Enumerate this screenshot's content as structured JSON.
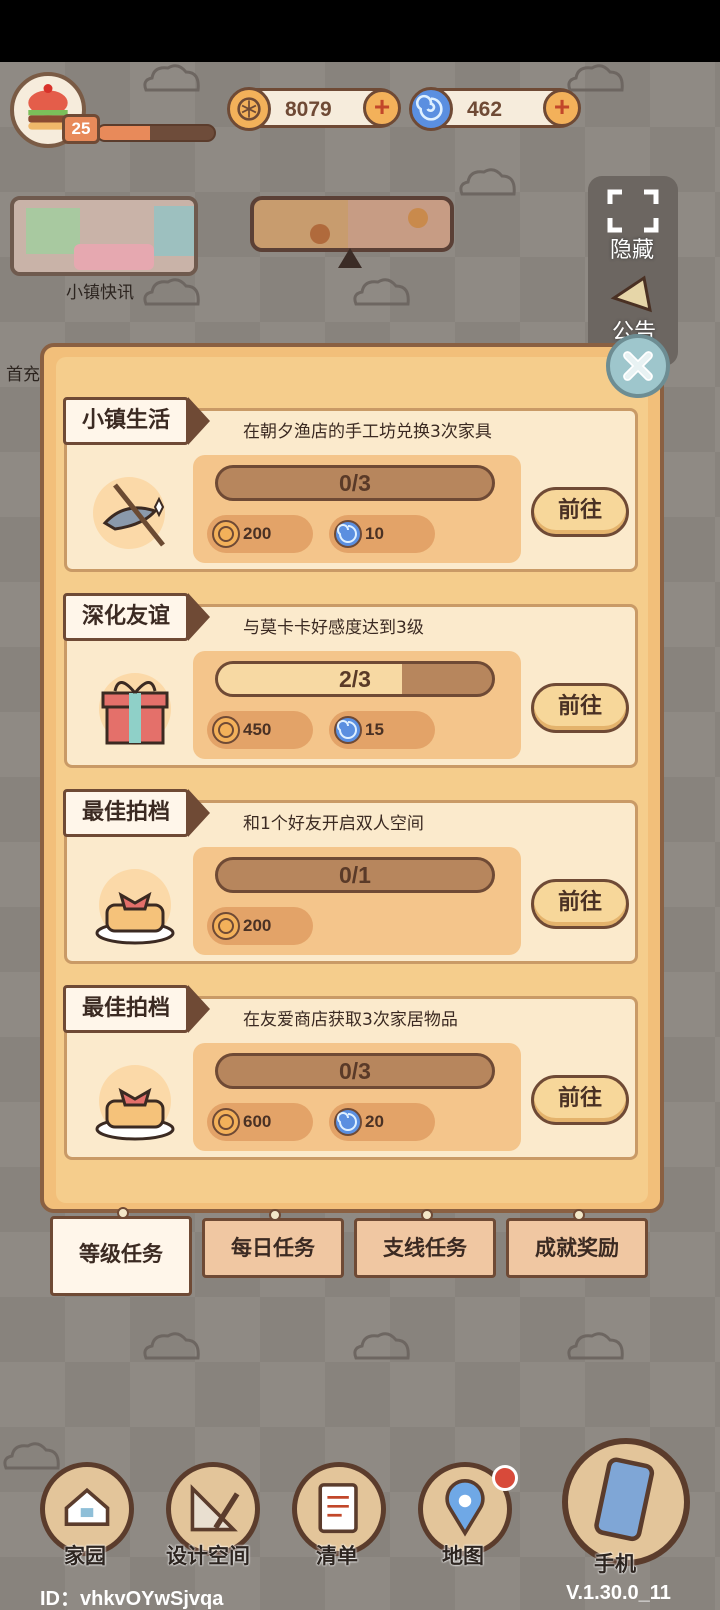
{
  "hud": {
    "level": "25",
    "xp_progress": 0.45,
    "coins": "8079",
    "gems": "462",
    "coin_icon": "coin-icon",
    "gem_icon": "swirl-gem-icon",
    "add_icon": "plus-icon"
  },
  "side": {
    "news_label": "小镇快讯",
    "hide_label": "隐藏",
    "notice_label": "公告",
    "first_charge_label": "首充"
  },
  "quests": [
    {
      "title": "小镇生活",
      "description": "在朝夕渔店的手工坊兑换3次家具",
      "icon": "fish-rod-icon",
      "progress_text": "0/3",
      "progress": 0,
      "rewards": [
        {
          "type": "coin",
          "amount": "200"
        },
        {
          "type": "gem",
          "amount": "10"
        }
      ],
      "button": "前往"
    },
    {
      "title": "深化友谊",
      "description": "与莫卡卡好感度达到3级",
      "icon": "gift-box-icon",
      "progress_text": "2/3",
      "progress": 0.667,
      "rewards": [
        {
          "type": "coin",
          "amount": "450"
        },
        {
          "type": "gem",
          "amount": "15"
        }
      ],
      "button": "前往"
    },
    {
      "title": "最佳拍档",
      "description": "和1个好友开启双人空间",
      "icon": "pancake-icon",
      "progress_text": "0/1",
      "progress": 0,
      "rewards": [
        {
          "type": "coin",
          "amount": "200"
        }
      ],
      "button": "前往"
    },
    {
      "title": "最佳拍档",
      "description": "在友爱商店获取3次家居物品",
      "icon": "pancake-icon",
      "progress_text": "0/3",
      "progress": 0,
      "rewards": [
        {
          "type": "coin",
          "amount": "600"
        },
        {
          "type": "gem",
          "amount": "20"
        }
      ],
      "button": "前往"
    }
  ],
  "tabs": [
    {
      "label": "等级任务",
      "active": true
    },
    {
      "label": "每日任务",
      "active": false
    },
    {
      "label": "支线任务",
      "active": false
    },
    {
      "label": "成就奖励",
      "active": false
    }
  ],
  "nav": {
    "home": "家园",
    "design": "设计空间",
    "list": "清单",
    "map": "地图",
    "phone": "手机"
  },
  "footer": {
    "player_id": "ID：vhkvOYwSjvqa",
    "version": "V.1.30.0_11"
  },
  "colors": {
    "accent_brown": "#6f4a35",
    "panel_orange": "#f2bf7a",
    "card_cream": "#fbeacc",
    "coin_gold": "#f3b15a",
    "gem_blue": "#5b8fe0"
  }
}
